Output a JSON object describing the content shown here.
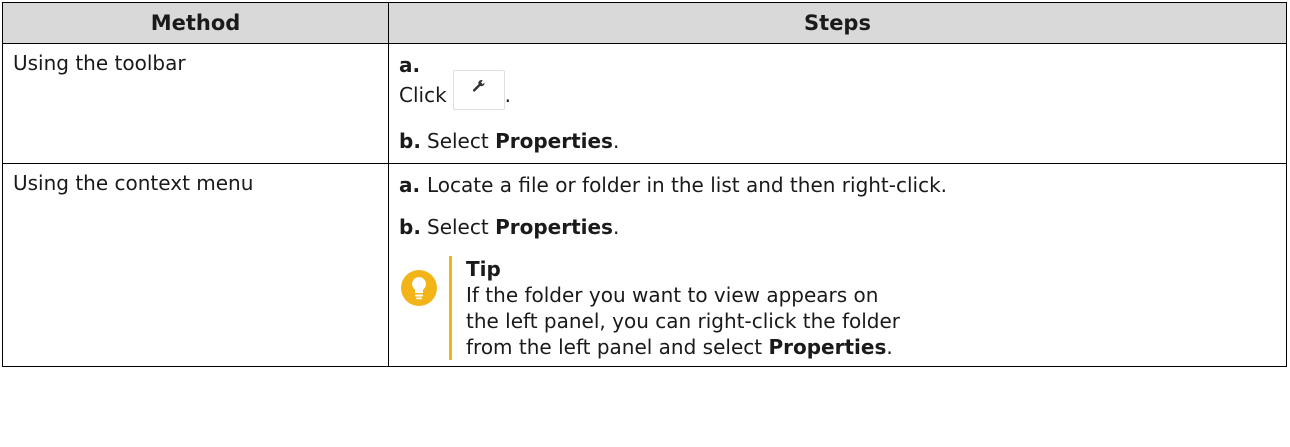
{
  "table": {
    "headers": {
      "method": "Method",
      "steps": "Steps"
    },
    "rows": [
      {
        "method": "Using the toolbar",
        "steps": [
          {
            "letter": "a.",
            "text": "Click",
            "icon": "wrench-icon",
            "suffix": "."
          },
          {
            "letter": "b.",
            "text": "Select ",
            "bold": "Properties",
            "suffix": "."
          }
        ]
      },
      {
        "method": "Using the context menu",
        "steps": [
          {
            "letter": "a.",
            "text": "Locate a file or folder in the list and then right-click."
          },
          {
            "letter": "b.",
            "text": "Select ",
            "bold": "Properties",
            "suffix": "."
          }
        ],
        "tip": {
          "icon": "lightbulb-icon",
          "title": "Tip",
          "text": "If the folder you want to view appears on the left panel, you can right-click the folder from the left panel and select ",
          "bold": "Properties",
          "suffix": "."
        }
      }
    ]
  },
  "colors": {
    "header_bg": "#d9d9d9",
    "tip_accent": "#f2b418"
  }
}
